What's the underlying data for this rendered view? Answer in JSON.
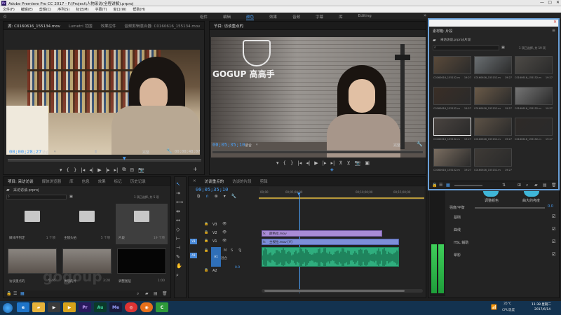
{
  "window": {
    "title": "Adobe Premiere Pro CC 2017 - F:\\Project\\人物采访(全程讲解).prproj",
    "menu": [
      "文件(F)",
      "编辑(E)",
      "剪辑(C)",
      "序列(S)",
      "标记(M)",
      "字幕(T)",
      "窗口(W)",
      "帮助(H)"
    ],
    "workspaces": [
      "组件",
      "编辑",
      "颜色",
      "效果",
      "音频",
      "字幕",
      "库",
      "Editing"
    ],
    "active_workspace": "颜色"
  },
  "source_monitor": {
    "tabs": [
      "源: C0160616_155134.mov",
      "Lumetri 范围",
      "效果控件",
      "音频剪辑混合器: C0160616_155134.mov"
    ],
    "timecode_in": "00;00;28;27",
    "fit_label": "适合",
    "quality_label": "完整",
    "timecode_out": "00;00;48;07"
  },
  "program_monitor": {
    "title": "节目: 访谈重点的",
    "timecode": "00;05;35;10",
    "fit_label": "适合",
    "quality_label": "完整",
    "wall_sign": "GOGUP 高高手"
  },
  "bin_float": {
    "title": "素材箱: 片段",
    "path": "采访访谈.prproj\\片段",
    "count": "1 项已选择, 共 19 项",
    "items": [
      {
        "name": "C0160616_155152.mov",
        "dur": "19:27"
      },
      {
        "name": "C0160616_155152.mov",
        "dur": "19:27"
      },
      {
        "name": "C0160616_155152.mov",
        "dur": "19:27"
      },
      {
        "name": "C0160616_155152.mov",
        "dur": "19:27"
      },
      {
        "name": "C0160616_155152.mov",
        "dur": "19:27"
      },
      {
        "name": "C0160616_155152.mov",
        "dur": "19:27"
      },
      {
        "name": "C0160616_155152.mov",
        "dur": "19:27"
      },
      {
        "name": "C0160616_155152.mov",
        "dur": "19:27"
      },
      {
        "name": "C0160616_155152.mov",
        "dur": "19:27"
      },
      {
        "name": "C0160616_155152.mov",
        "dur": "19:27"
      },
      {
        "name": "C0160616_155152.mov",
        "dur": "19:27"
      }
    ]
  },
  "project_panel": {
    "tabs": [
      "项目: 采访访谈",
      "媒体浏览器",
      "库",
      "信息",
      "效果",
      "标记",
      "历史记录"
    ],
    "project_file": "采访访谈.prproj",
    "count": "1 项已选择, 共 5 项",
    "items": [
      {
        "name": "媒体序列定",
        "meta": "1 个项"
      },
      {
        "name": "主镜头拍",
        "meta": "5 个项"
      },
      {
        "name": "片段",
        "meta": "19 个项"
      },
      {
        "name": "访谈重点的",
        "meta": "5:46"
      },
      {
        "name": "访谈的片",
        "meta": "3:20"
      },
      {
        "name": "调整图层",
        "meta": "1:00"
      }
    ]
  },
  "timeline": {
    "tabs": [
      "访谈重点的",
      "访谈的片段",
      "剪辑"
    ],
    "timecode": "00;05;35;10",
    "ruler": [
      "00;00",
      "00;05;00;00",
      "00;10;00;00",
      "00;15;00;00"
    ],
    "tracks": [
      "V3",
      "V2",
      "V1",
      "A1",
      "A2"
    ],
    "clip_v2": "颜色拉.mov",
    "clip_v1": "主视拉.mov [V]",
    "mix_label": "混合",
    "mix_value": "0.0"
  },
  "lumetri": {
    "label_a": "调整颜色",
    "label_b": "曲大的亮度",
    "slider_label": "强度/平衡",
    "slider_value": "0.0",
    "sections": [
      "基础",
      "曲线",
      "HSL 辅助",
      "晕影"
    ]
  },
  "taskbar": {
    "clock_time": "11:38 星期二",
    "clock_date": "2017/6/14",
    "temp": "35°C",
    "cpu": "CPU温度"
  },
  "watermark": "gogoup",
  "colors": {
    "accent_blue": "#4a9ff5",
    "clip_purple": "#a98bd6",
    "clip_blue": "#7d8fd8",
    "audio_green": "#2fae7e",
    "taskbar": "#13324f"
  }
}
